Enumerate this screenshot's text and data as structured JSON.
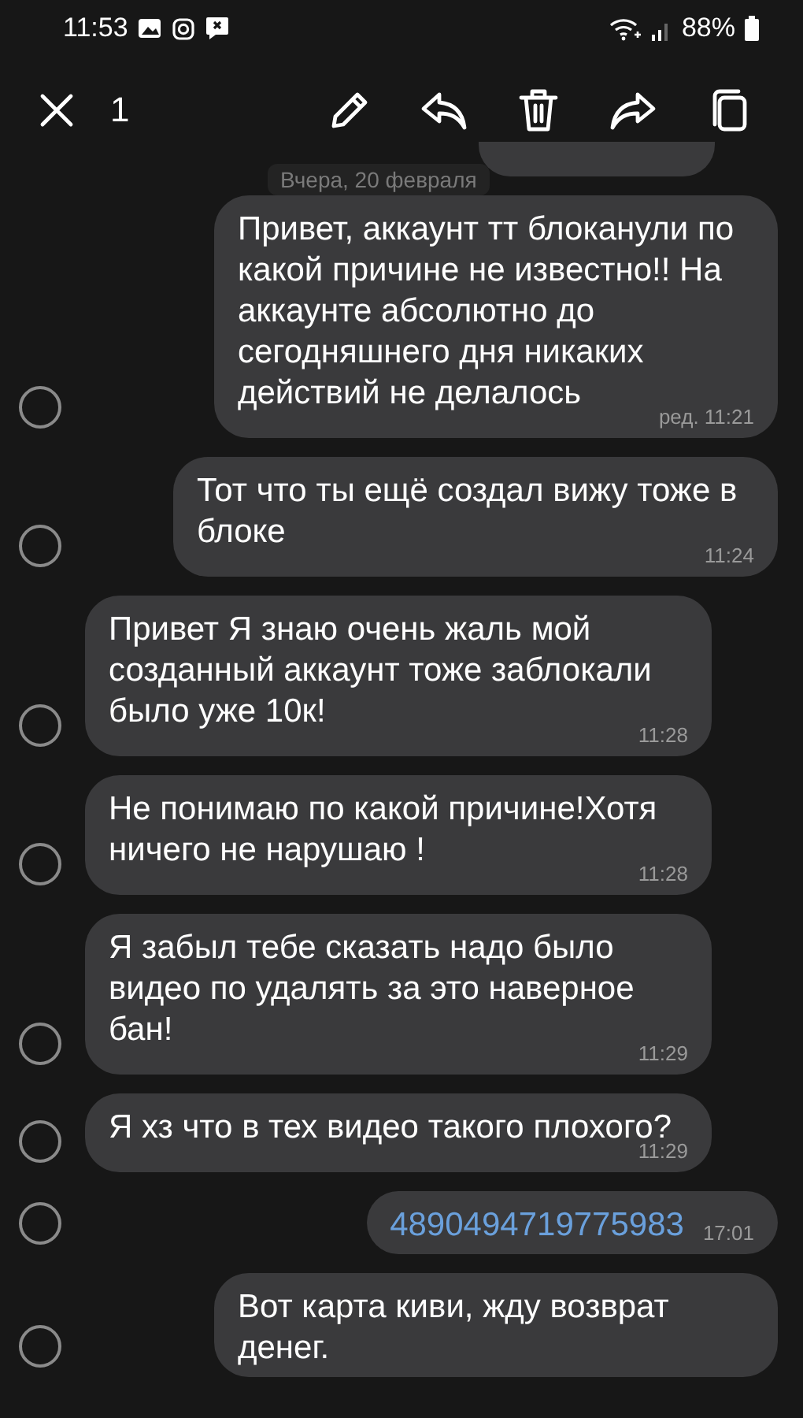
{
  "status_bar": {
    "time": "11:53",
    "battery": "88%"
  },
  "toolbar": {
    "selected_count": "1"
  },
  "date_chip": "Вчера, 20 февраля",
  "messages": [
    {
      "kind": "outgoing",
      "text": "Привет, аккаунт тт блоканули по какой причине не известно!! На аккаунте абсолютно до сегодняшнего дня никаких действий не делалось",
      "time": "ред. 11:21",
      "selected": false,
      "link": false
    },
    {
      "kind": "outgoing",
      "text": "Тот что ты ещё создал вижу тоже в блоке",
      "time": "11:24",
      "selected": false,
      "link": false
    },
    {
      "kind": "incoming",
      "text": "Привет Я знаю очень жаль мой созданный аккаунт тоже заблокали было уже 10к!",
      "time": "11:28",
      "selected": false,
      "link": false
    },
    {
      "kind": "incoming",
      "text": "Не понимаю по какой причине!Хотя ничего не нарушаю !",
      "time": "11:28",
      "selected": false,
      "link": false
    },
    {
      "kind": "incoming",
      "text": "Я забыл тебе сказать надо было видео по удалять за это наверное бан!",
      "time": "11:29",
      "selected": false,
      "link": false
    },
    {
      "kind": "incoming",
      "text": "Я хз что в тех видео такого плохого?",
      "time": "11:29",
      "selected": false,
      "link": false
    },
    {
      "kind": "outgoing",
      "text": "4890494719775983",
      "time": "17:01",
      "selected": false,
      "link": true
    },
    {
      "kind": "outgoing",
      "text": "Вот карта киви, жду возврат денег.",
      "selected": false,
      "link": false
    }
  ]
}
